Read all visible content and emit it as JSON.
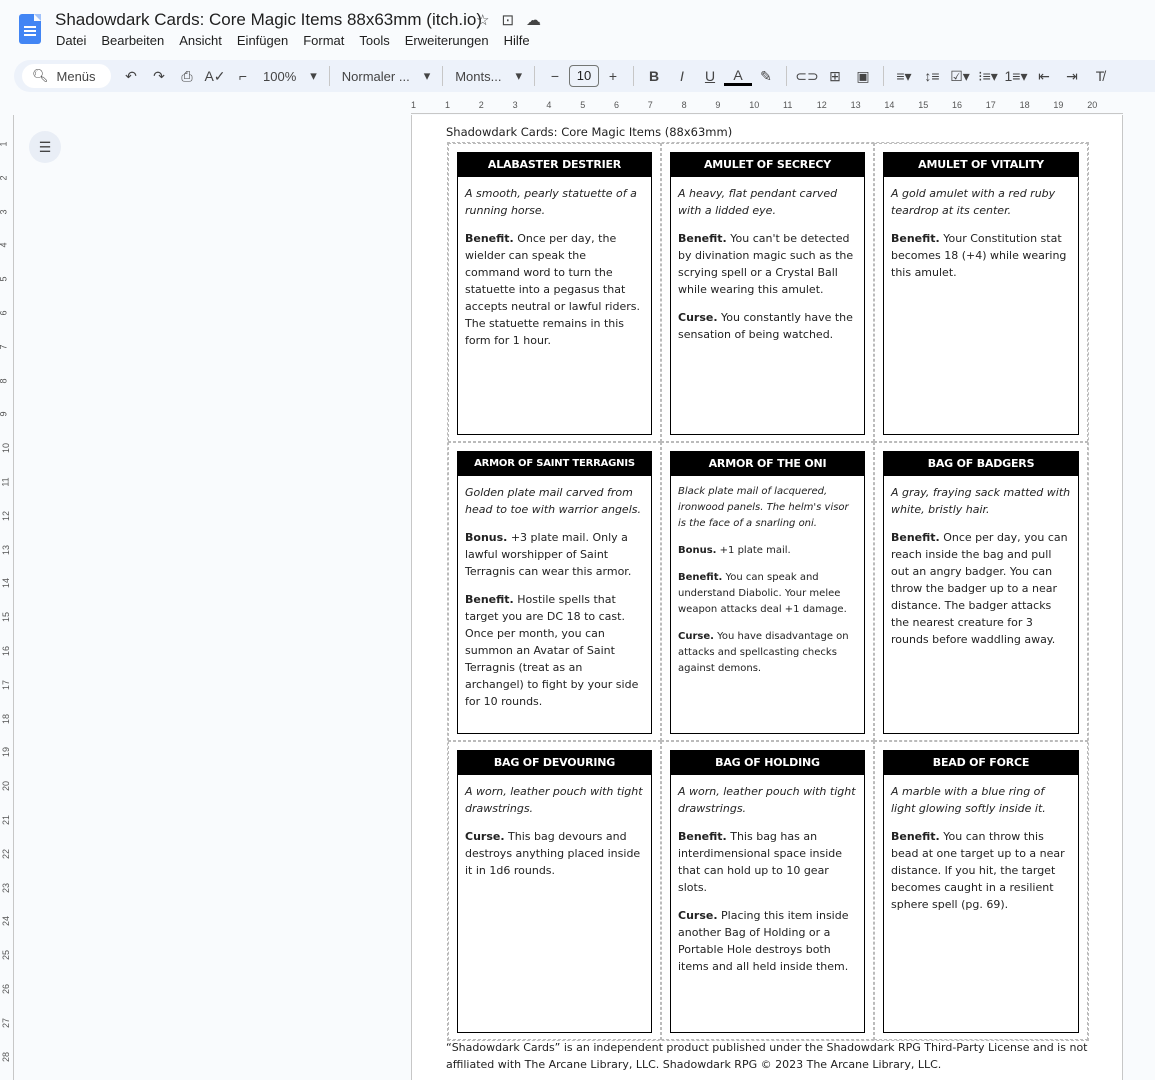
{
  "app": {
    "title": "Shadowdark Cards: Core Magic Items 88x63mm (itch.io)",
    "menu": [
      "Datei",
      "Bearbeiten",
      "Ansicht",
      "Einfügen",
      "Format",
      "Tools",
      "Erweiterungen",
      "Hilfe"
    ]
  },
  "toolbar": {
    "search": "Menüs",
    "zoom": "100%",
    "style": "Normaler ...",
    "font": "Monts...",
    "font_size": "10"
  },
  "ruler": {
    "h": [
      "1",
      "1",
      "2",
      "3",
      "4",
      "5",
      "6",
      "7",
      "8",
      "9",
      "10",
      "11",
      "12",
      "13",
      "14",
      "15",
      "16",
      "17",
      "18",
      "19",
      "20"
    ],
    "v": [
      "1",
      "2",
      "3",
      "4",
      "5",
      "6",
      "7",
      "8",
      "9",
      "10",
      "11",
      "12",
      "13",
      "14",
      "15",
      "16",
      "17",
      "18",
      "19",
      "20",
      "21",
      "22",
      "23",
      "24",
      "25",
      "26",
      "27",
      "28"
    ]
  },
  "doc": {
    "title": "Shadowdark Cards: Core Magic Items (88x63mm)",
    "footer": "“Shadowdark Cards” is an independent product published under the Shadowdark RPG Third-Party License and is not affiliated with The Arcane Library, LLC. Shadowdark RPG © 2023 The Arcane Library, LLC.",
    "cards": [
      {
        "title": "ALABASTER DESTRIER",
        "flavor": "A smooth, pearly statuette of a running horse.",
        "sections": [
          {
            "label": "Benefit.",
            "text": " Once per day, the wielder can speak the command word to turn the statuette into a pegasus that accepts neutral or lawful riders. The statuette remains in this form for 1 hour."
          }
        ]
      },
      {
        "title": "AMULET OF SECRECY",
        "flavor": "A heavy, flat pendant carved with a lidded eye.",
        "sections": [
          {
            "label": "Benefit.",
            "text": " You can't be detected by divination magic such as the scrying spell or a Crystal Ball while wearing this amulet."
          },
          {
            "label": "Curse.",
            "text": " You constantly have the sensation of being watched."
          }
        ]
      },
      {
        "title": "AMULET OF VITALITY",
        "flavor": "A gold amulet with a red ruby teardrop at its center.",
        "sections": [
          {
            "label": "Benefit.",
            "text": " Your Constitution stat becomes 18 (+4) while wearing this amulet."
          }
        ]
      },
      {
        "title": "ARMOR OF SAINT TERRAGNIS",
        "flavor": "Golden plate mail carved from head to toe with warrior angels.",
        "sections": [
          {
            "label": "Bonus.",
            "text": " +3 plate mail. Only a lawful worshipper of Saint Terragnis can wear this armor."
          },
          {
            "label": "Benefit.",
            "text": " Hostile spells that target you are DC 18 to cast. Once per month, you can summon an Avatar of Saint Terragnis (treat as an archangel) to fight by your side for 10 rounds."
          }
        ]
      },
      {
        "title": "ARMOR OF THE ONI",
        "flavor": "Black plate mail of lacquered, ironwood panels. The helm's visor is the face of a snarling oni.",
        "sections": [
          {
            "label": "Bonus.",
            "text": " +1 plate mail."
          },
          {
            "label": "Benefit.",
            "text": " You can speak and understand Diabolic. Your melee weapon attacks deal +1 damage."
          },
          {
            "label": "Curse.",
            "text": " You have disadvantage on attacks and spellcasting checks against demons."
          }
        ]
      },
      {
        "title": "BAG OF BADGERS",
        "flavor": "A gray, fraying sack matted with white, bristly hair.",
        "sections": [
          {
            "label": "Benefit.",
            "text": " Once per day, you can reach inside the bag and pull out an angry badger. You can throw the badger up to a near distance. The badger attacks the nearest creature for 3 rounds before waddling away."
          }
        ]
      },
      {
        "title": "BAG OF DEVOURING",
        "flavor": "A worn, leather pouch with tight drawstrings.",
        "sections": [
          {
            "label": "Curse.",
            "text": " This bag devours and destroys anything placed inside it in 1d6 rounds."
          }
        ]
      },
      {
        "title": "BAG OF HOLDING",
        "flavor": "A worn, leather pouch with tight drawstrings.",
        "sections": [
          {
            "label": "Benefit.",
            "text": " This bag has an interdimensional space inside that can hold up to 10 gear slots."
          },
          {
            "label": "Curse.",
            "text": " Placing this item inside another Bag of Holding or a Portable Hole destroys both items and all held inside them."
          }
        ]
      },
      {
        "title": "BEAD OF FORCE",
        "flavor": "A marble with a blue ring of light glowing softly inside it.",
        "sections": [
          {
            "label": "Benefit.",
            "text": " You can throw this bead at one target up to a near distance. If you hit, the target becomes caught in a resilient sphere spell (pg. 69)."
          }
        ]
      }
    ]
  }
}
